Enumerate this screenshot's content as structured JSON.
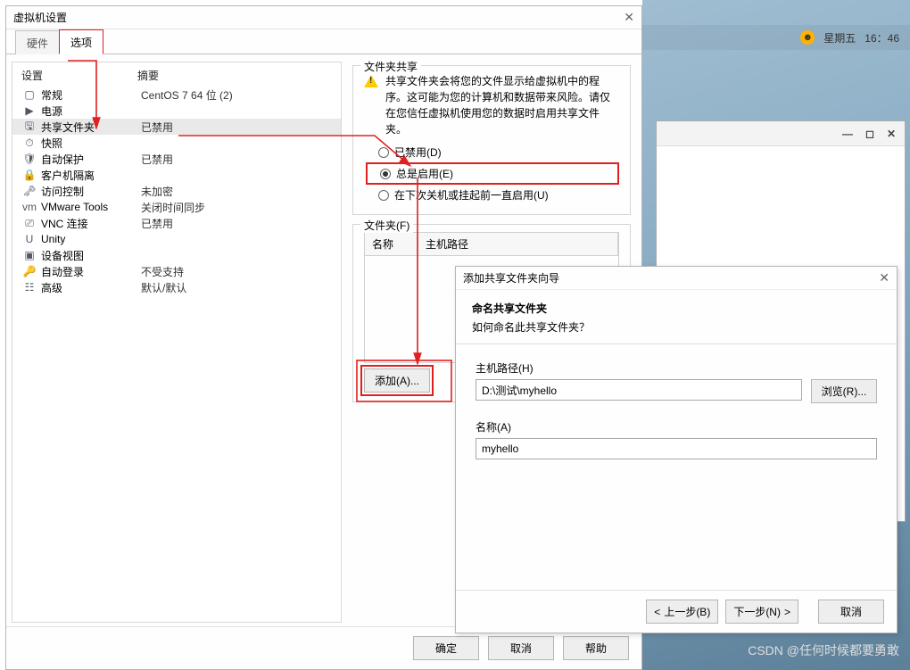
{
  "window": {
    "title": "虚拟机设置",
    "close_glyph": "✕"
  },
  "tabs": {
    "hardware": "硬件",
    "options": "选项"
  },
  "left_header": {
    "col1": "设置",
    "col2": "摘要"
  },
  "settings": [
    {
      "icon": "▢",
      "name": "常规",
      "summary": "CentOS 7 64 位 (2)"
    },
    {
      "icon": "▶",
      "name": "电源",
      "summary": ""
    },
    {
      "icon": "🖫",
      "name": "共享文件夹",
      "summary": "已禁用",
      "selected": true
    },
    {
      "icon": "⏱",
      "name": "快照",
      "summary": ""
    },
    {
      "icon": "🛡",
      "name": "自动保护",
      "summary": "已禁用"
    },
    {
      "icon": "🔒",
      "name": "客户机隔离",
      "summary": ""
    },
    {
      "icon": "🗝",
      "name": "访问控制",
      "summary": "未加密"
    },
    {
      "icon": "vm",
      "name": "VMware Tools",
      "summary": "关闭时间同步"
    },
    {
      "icon": "⎚",
      "name": "VNC 连接",
      "summary": "已禁用"
    },
    {
      "icon": "U",
      "name": "Unity",
      "summary": ""
    },
    {
      "icon": "▣",
      "name": "设备视图",
      "summary": ""
    },
    {
      "icon": "🔑",
      "name": "自动登录",
      "summary": "不受支持"
    },
    {
      "icon": "☷",
      "name": "高级",
      "summary": "默认/默认"
    }
  ],
  "share": {
    "group_title": "文件夹共享",
    "warning": "共享文件夹会将您的文件显示给虚拟机中的程序。这可能为您的计算机和数据带来风险。请仅在您信任虚拟机使用您的数据时启用共享文件夹。",
    "opt_disabled": "已禁用(D)",
    "opt_always": "总是启用(E)",
    "opt_until": "在下次关机或挂起前一直启用(U)"
  },
  "folders": {
    "group_title": "文件夹(F)",
    "col_name": "名称",
    "col_path": "主机路径",
    "btn_add": "添加(A)..."
  },
  "dialog_buttons": {
    "ok": "确定",
    "cancel": "取消",
    "help": "帮助"
  },
  "wizard": {
    "title": "添加共享文件夹向导",
    "heading": "命名共享文件夹",
    "subheading": "如何命名此共享文件夹？",
    "host_label": "主机路径(H)",
    "host_value": "D:\\测试\\myhello",
    "browse": "浏览(R)...",
    "name_label": "名称(A)",
    "name_value": "myhello",
    "back": "上一步(B)",
    "next": "下一步(N)",
    "cancel": "取消"
  },
  "desktop": {
    "day": "星期五",
    "time": "16：46"
  },
  "watermark": "CSDN @任何时候都要勇敢"
}
